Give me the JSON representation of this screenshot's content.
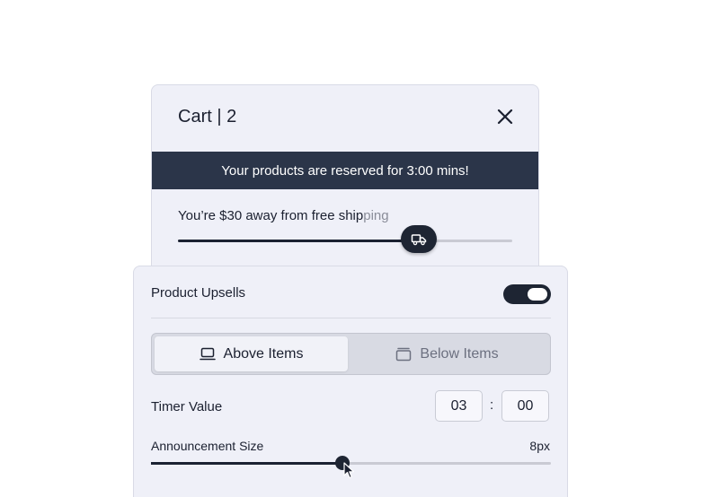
{
  "cart": {
    "title": "Cart | 2",
    "banner": "Your products are reserved for 3:00 mins!",
    "shipping_text_main": "You’re $30 away from free ship",
    "shipping_text_fade": "ping",
    "shipping_progress": 0.72
  },
  "settings": {
    "upsells_label": "Product Upsells",
    "upsells_enabled": true,
    "placement": {
      "above_label": "Above Items",
      "below_label": "Below Items",
      "selected": "Above Items"
    },
    "timer": {
      "label": "Timer Value",
      "minutes": "03",
      "separator": ":",
      "seconds": "00"
    },
    "announcement": {
      "label": "Announcement Size",
      "value": "8px",
      "slider_fraction": 0.478
    }
  },
  "colors": {
    "dark": "#1e2533",
    "banner": "#2b3549",
    "panel": "#eff0f8"
  },
  "icons": {
    "close": "close-icon",
    "truck": "truck-icon",
    "above": "laptop-icon",
    "below": "window-icon",
    "cursor": "mouse-pointer-icon"
  }
}
